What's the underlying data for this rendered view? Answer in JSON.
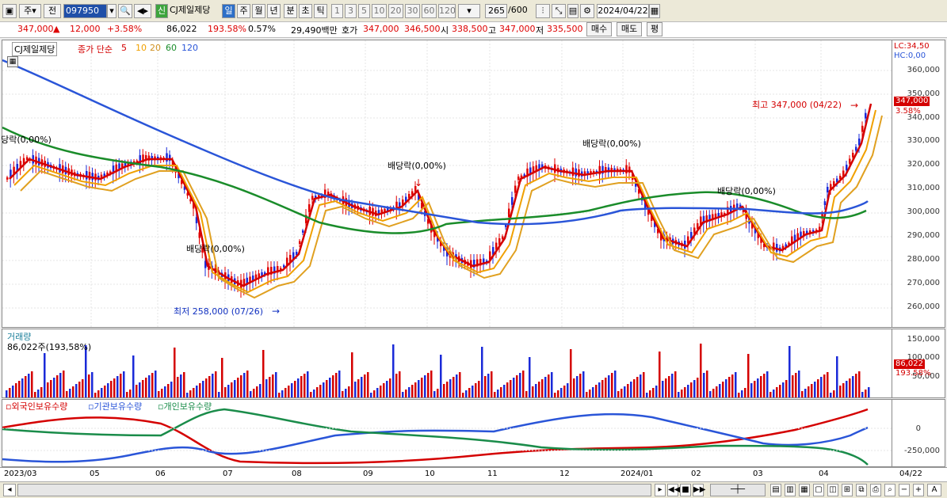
{
  "toolbar": {
    "period_main": "주",
    "mode": "전",
    "code": "097950",
    "sin": "신",
    "name": "CJ제일제당",
    "tabs": [
      "일",
      "주",
      "월",
      "년",
      "분",
      "초",
      "틱"
    ],
    "active_tab": "일",
    "minute_opts": [
      "1",
      "3",
      "5",
      "10",
      "20",
      "30",
      "60",
      "120"
    ],
    "count": "265",
    "count_total": "/600",
    "date": "2024/04/22"
  },
  "quote": {
    "price": "347,000",
    "change": "12,000",
    "change_pct": "+3.58%",
    "volume": "86,022",
    "volume_pct": "193.58%",
    "turnover": "0.57%",
    "amount": "29,490백만",
    "ask_label": "호가",
    "ask": "347,000",
    "bid": "346,500",
    "open_label": "시",
    "open": "338,500",
    "high_label": "고",
    "high": "347,000",
    "low_label": "저",
    "low": "335,500",
    "buy_label": "매수",
    "sell_label": "매도",
    "eval_label": "평"
  },
  "price_pane": {
    "legend_name": "CJ제일제당",
    "legend_ma": "종가 단순",
    "ma_periods": [
      "5",
      "10",
      "20",
      "60",
      "120"
    ],
    "ma_colors": [
      "#d40000",
      "#f0a000",
      "#e0a020",
      "#1a8c2a",
      "#2a55d8"
    ],
    "lc": "LC:34,50",
    "hc": "HC:0,00",
    "y_ticks": [
      "360,000",
      "350,000",
      "340,000",
      "330,000",
      "320,000",
      "310,000",
      "300,000",
      "290,000",
      "280,000",
      "270,000",
      "260,000"
    ],
    "last_price": "347,000",
    "last_pct": "3.58%",
    "annot_high": "최고 347,000 (04/22)",
    "annot_low": "최저 258,000 (07/26)",
    "div_label": "배당락(0,00%)"
  },
  "volume_pane": {
    "title": "거래량",
    "value": "86,022주(193,58%)",
    "y_ticks": [
      "150,000",
      "100,000",
      "50,000"
    ],
    "last_vol": "86,022",
    "last_pct": "193.58%"
  },
  "holdings_pane": {
    "legends": [
      "외국인보유수량",
      "기관보유수량",
      "개인보유수량"
    ],
    "legend_colors": [
      "#d40000",
      "#2a55d8",
      "#1a8c4a"
    ],
    "y_ticks": [
      "0",
      "-250,000"
    ]
  },
  "x_axis": {
    "labels": [
      "2023/03",
      "05",
      "06",
      "07",
      "08",
      "09",
      "10",
      "11",
      "12",
      "2024/01",
      "02",
      "03",
      "04"
    ],
    "right_label": "04/22"
  }
}
